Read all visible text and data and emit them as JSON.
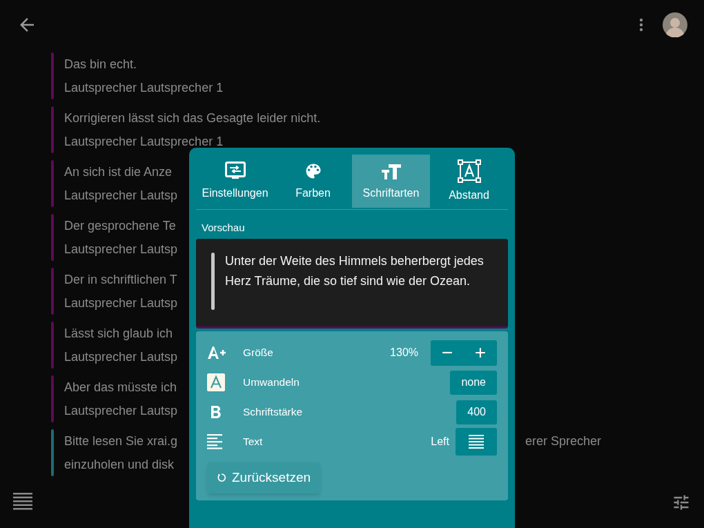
{
  "transcript": [
    {
      "text": "Das bin echt.",
      "speaker": "Lautsprecher Lautsprecher 1",
      "color": "#5c0b52"
    },
    {
      "text": "Korrigieren lässt sich das Gesagte leider nicht.",
      "speaker": "Lautsprecher Lautsprecher 1",
      "color": "#5c0b52"
    },
    {
      "text": "An sich ist die Anze",
      "speaker": "Lautsprecher Lautsp",
      "color": "#5c0b52"
    },
    {
      "text": "Der gesprochene Te",
      "speaker": "Lautsprecher Lautsp",
      "color": "#5c0b52"
    },
    {
      "text": "Der in schriftlichen T",
      "speaker": "Lautsprecher Lautsp",
      "color": "#5c0b52"
    },
    {
      "text": "Lässt sich glaub ich",
      "speaker": "Lautsprecher Lautsp",
      "color": "#5c0b52"
    },
    {
      "text": "Aber das müsste ich",
      "speaker": "Lautsprecher Lautsp",
      "color": "#5c0b52"
    },
    {
      "text": "Bitte lesen Sie xrai.g",
      "text_right": "erer Sprecher",
      "line2": "einzuholen und disk",
      "color": "#1d6c74"
    }
  ],
  "panel": {
    "tabs": [
      {
        "label": "Einstellungen",
        "selected": false
      },
      {
        "label": "Farben",
        "selected": false
      },
      {
        "label": "Schriftarten",
        "selected": true
      },
      {
        "label": "Abstand",
        "selected": false
      }
    ],
    "preview_label": "Vorschau",
    "preview_text": "Unter der Weite des Himmels beherbergt jedes Herz Träume, die so tief sind wie der Ozean.",
    "settings": [
      {
        "kind": "stepper",
        "label": "Größe",
        "reading": "130%",
        "minus": "−",
        "plus": "+"
      },
      {
        "kind": "value",
        "label": "Umwandeln",
        "value": "none"
      },
      {
        "kind": "value",
        "label": "Schriftstärke",
        "value": "400"
      },
      {
        "kind": "align",
        "label": "Text",
        "reading": "Left"
      }
    ],
    "reset_button": "Zurücksetzen"
  }
}
